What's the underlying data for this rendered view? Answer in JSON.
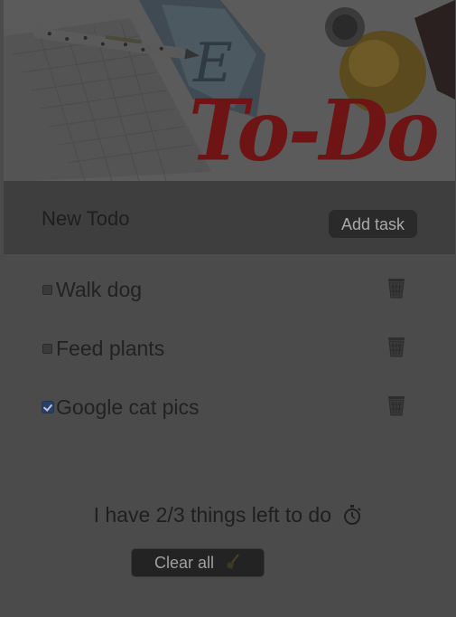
{
  "hero": {
    "title_art": "To-Do"
  },
  "new_todo": {
    "placeholder": "New Todo",
    "value": "",
    "add_label": "Add task"
  },
  "tasks": [
    {
      "label": "Walk dog",
      "done": false,
      "delete_icon": "trash-icon"
    },
    {
      "label": "Feed plants",
      "done": false,
      "delete_icon": "trash-icon"
    },
    {
      "label": "Google cat pics",
      "done": true,
      "delete_icon": "trash-icon"
    }
  ],
  "summary": {
    "text": "I have 2/3 things left to do",
    "icon": "stopwatch-icon"
  },
  "clear_all": {
    "label": "Clear all",
    "icon": "broom-icon"
  },
  "colors": {
    "background": "#4b4b4b",
    "input_bar": "#3e3e3e",
    "button_bg": "#2a2a2a",
    "title_red": "#6e1414",
    "checkbox_checked": "#2a3f66"
  }
}
